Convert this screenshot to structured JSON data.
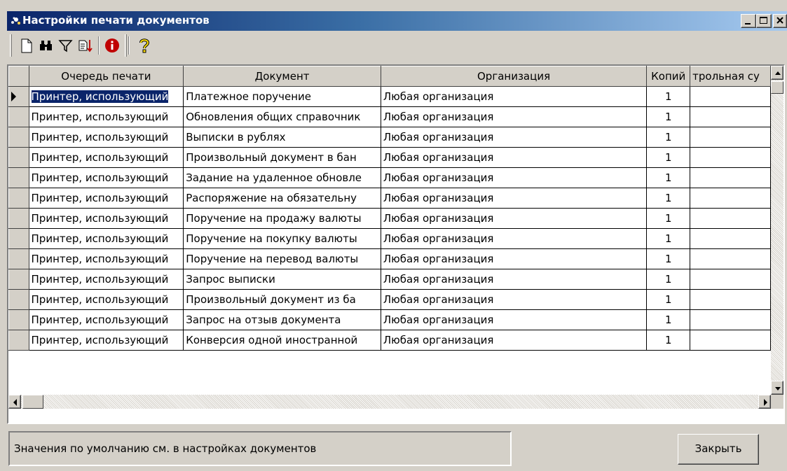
{
  "window": {
    "title": "Настройки печати документов"
  },
  "toolbar": {
    "tools": [
      "new-document-icon",
      "find-binoculars-icon",
      "filter-icon",
      "sort-icon",
      "info-icon",
      "help-icon"
    ]
  },
  "table": {
    "columns": [
      "Очередь печати",
      "Документ",
      "Организация",
      "Копий",
      "трольная су"
    ],
    "selected_row": 0,
    "rows": [
      [
        "Принтер, использующий",
        "Платежное поручение",
        "Любая организация",
        "1",
        ""
      ],
      [
        "Принтер, использующий",
        "Обновления общих справочник",
        "Любая организация",
        "1",
        ""
      ],
      [
        "Принтер, использующий",
        "Выписки в рублях",
        "Любая организация",
        "1",
        ""
      ],
      [
        "Принтер, использующий",
        "Произвольный документ в бан",
        "Любая организация",
        "1",
        ""
      ],
      [
        "Принтер, использующий",
        "Задание на удаленное обновле",
        "Любая организация",
        "1",
        ""
      ],
      [
        "Принтер, использующий",
        "Распоряжение на обязательну",
        "Любая организация",
        "1",
        ""
      ],
      [
        "Принтер, использующий",
        "Поручение на продажу валюты",
        "Любая организация",
        "1",
        ""
      ],
      [
        "Принтер, использующий",
        "Поручение на покупку валюты",
        "Любая организация",
        "1",
        ""
      ],
      [
        "Принтер, использующий",
        "Поручение на перевод валюты",
        "Любая организация",
        "1",
        ""
      ],
      [
        "Принтер, использующий",
        "Запрос выписки",
        "Любая организация",
        "1",
        ""
      ],
      [
        "Принтер, использующий",
        "Произвольный документ из ба",
        "Любая организация",
        "1",
        ""
      ],
      [
        "Принтер, использующий",
        "Запрос на отзыв документа",
        "Любая организация",
        "1",
        ""
      ],
      [
        "Принтер, использующий",
        "Конверсия одной иностранной",
        "Любая организация",
        "1",
        ""
      ]
    ]
  },
  "status": {
    "text": "Значения по умолчанию см. в настройках документов"
  },
  "buttons": {
    "close_label": "Закрыть"
  },
  "colors": {
    "title_start": "#0a246a",
    "title_end": "#a6caf0",
    "face": "#d4d0c8",
    "selection": "#0a246a"
  }
}
